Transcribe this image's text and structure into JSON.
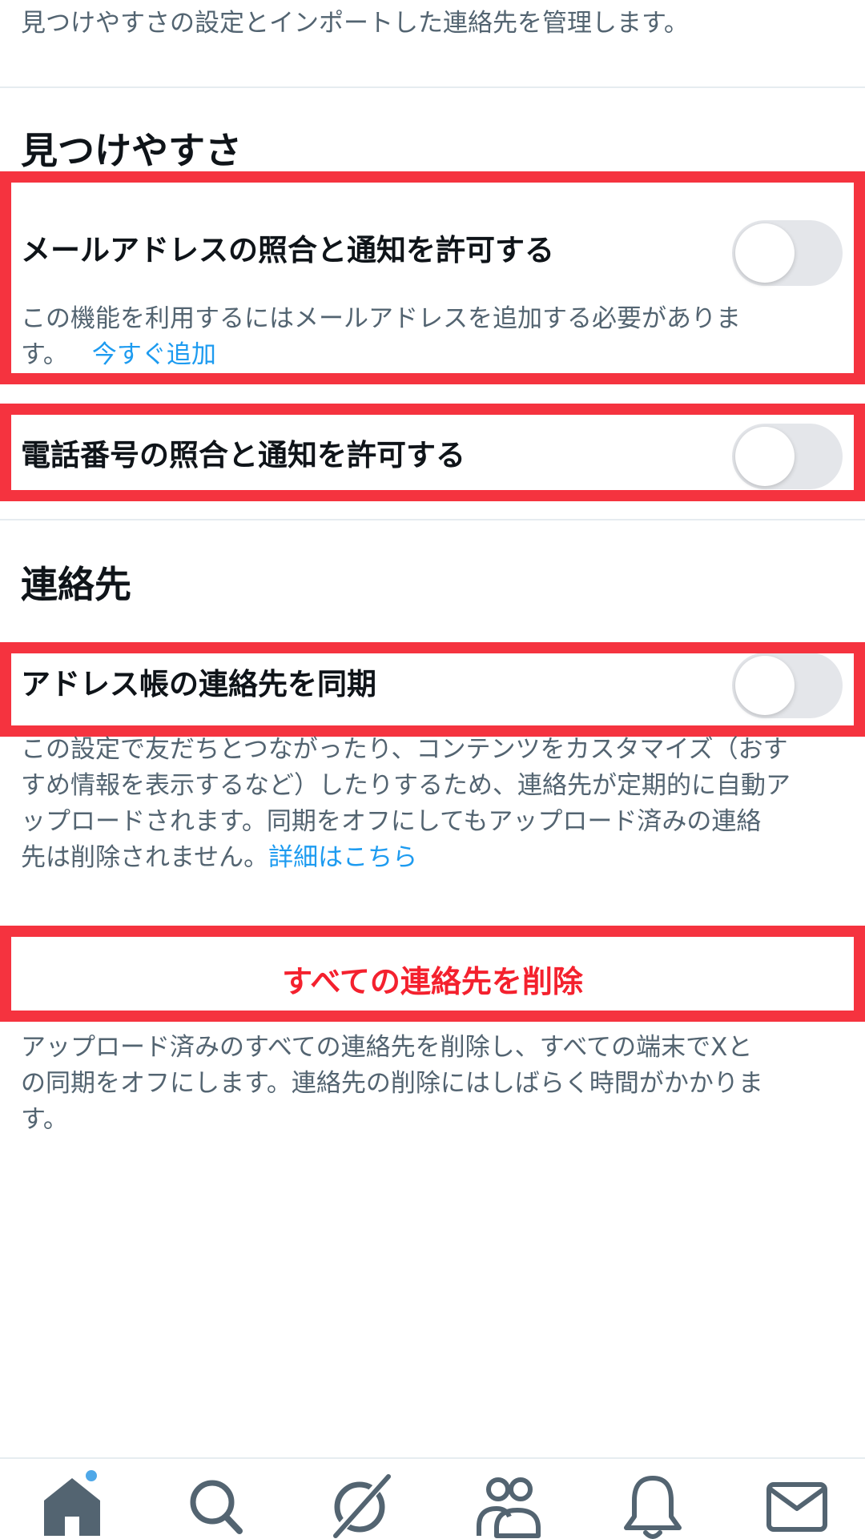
{
  "intro_text": "見つけやすさの設定とインポートした連絡先を管理します。",
  "discoverability": {
    "title": "見つけやすさ",
    "email_match": {
      "label": "メールアドレスの照合と通知を許可する",
      "description_line1": "この機能を利用するにはメールアドレスを追加する必要がありま",
      "description_line2": "す。",
      "link": "今すぐ追加",
      "enabled": false
    },
    "phone_match": {
      "label": "電話番号の照合と通知を許可する",
      "enabled": false
    }
  },
  "contacts": {
    "title": "連絡先",
    "sync": {
      "label": "アドレス帳の連絡先を同期",
      "enabled": false,
      "description_line1": "この設定で友だちとつながったり、コンテンツをカスタマイズ（おす",
      "description_line2": "すめ情報を表示するなど）したりするため、連絡先が定期的に自動ア",
      "description_line3": "ップロードされます。同期をオフにしてもアップロード済みの連絡",
      "description_line4": "先は削除されません。",
      "link": "詳細はこちら"
    },
    "remove_all": {
      "label": "すべての連絡先を削除",
      "description_line1": "アップロード済みのすべての連絡先を削除し、すべての端末でXと",
      "description_line2": "の同期をオフにします。連絡先の削除にはしばらく時間がかかりま",
      "description_line3": "す。"
    }
  },
  "bottom_nav": {
    "items": [
      "home-icon",
      "search-icon",
      "grok-icon",
      "communities-icon",
      "notifications-icon",
      "messages-icon"
    ],
    "home_has_badge": true
  },
  "colors": {
    "highlight": "#f5333f",
    "link": "#1d9bf0",
    "danger": "#f4212e",
    "toggle_off": "#e4e6ea",
    "nav_icon": "#536471"
  }
}
